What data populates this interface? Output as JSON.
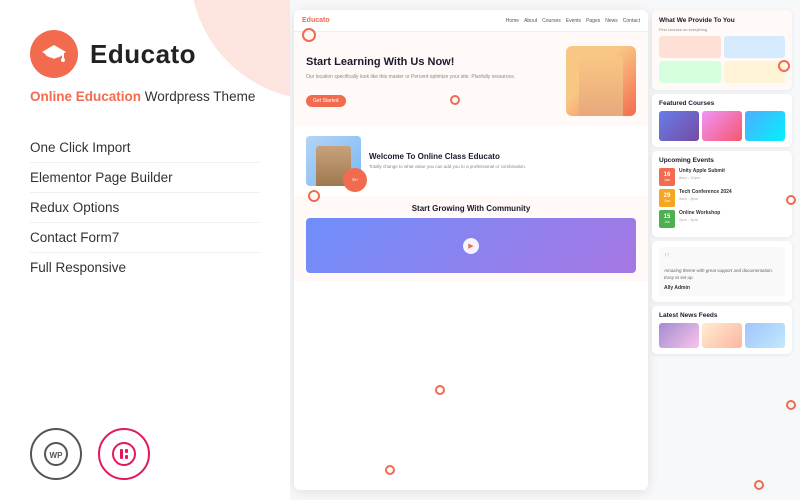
{
  "brand": {
    "name": "Educato",
    "tagline_prefix": "Online Education",
    "tagline_suffix": "Wordpress Theme"
  },
  "features": [
    "One Click Import",
    "Elementor Page Builder",
    "Redux Options",
    "Contact Form7",
    "Full Responsive"
  ],
  "badges": [
    {
      "id": "wordpress",
      "label": "WP"
    },
    {
      "id": "elementor",
      "label": "E"
    }
  ],
  "preview": {
    "nav_logo": "Educato",
    "nav_links": [
      "Home",
      "About",
      "Courses",
      "Events",
      "Pages",
      "News",
      "Contact"
    ],
    "hero_title": "Start Learning With Us Now!",
    "hero_sub": "Our location specifically look like this master or Percent optimize your site. Planfully resources.",
    "hero_btn": "Get Started",
    "welcome_title": "Welcome To Online Class Educato",
    "welcome_sub": "Totally change to what value you can add you to a professional or combination.",
    "years_exp": "30+",
    "community_title": "Start Growing With Community",
    "side_hero_title": "What We Provide To You",
    "side_hero_sub": "Find courses on everything",
    "featured_courses": "Featured Courses",
    "upcoming_events": "Upcoming Events",
    "events": [
      {
        "day": "16",
        "month": "Jun",
        "title": "Unity Apple Submit",
        "time": "8am - 10pm"
      },
      {
        "day": "29",
        "month": "Jun",
        "title": "Tech Conference 2024",
        "time": "9am - 5pm"
      },
      {
        "day": "15",
        "month": "Jul",
        "title": "Online Workshop",
        "time": "2pm - 4pm"
      }
    ],
    "testimonial_text": "Amazing theme with great support and documentation. Easy to set up.",
    "testimonial_author": "Ally Admin",
    "latest_news": "Latest News Feeds"
  },
  "colors": {
    "accent": "#f26b4e",
    "dark": "#1a1a2e",
    "light_bg": "#fff9f7"
  }
}
